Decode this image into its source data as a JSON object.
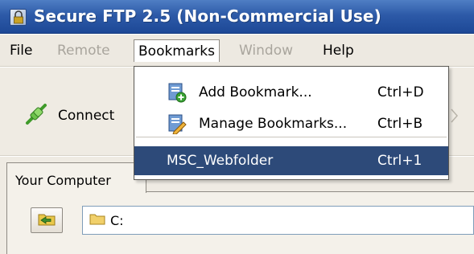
{
  "window": {
    "title": "Secure FTP 2.5 (Non-Commercial Use)"
  },
  "menubar": {
    "items": [
      {
        "label": "File",
        "enabled": true
      },
      {
        "label": "Remote",
        "enabled": false
      },
      {
        "label": "Bookmarks",
        "enabled": true,
        "open": true
      },
      {
        "label": "Window",
        "enabled": false
      },
      {
        "label": "Help",
        "enabled": true
      }
    ]
  },
  "bookmarks_menu": {
    "items": [
      {
        "label": "Add Bookmark...",
        "shortcut": "Ctrl+D",
        "icon": "add-bookmark-icon"
      },
      {
        "label": "Manage Bookmarks...",
        "shortcut": "Ctrl+B",
        "icon": "manage-bookmarks-icon"
      },
      {
        "label": "MSC_Webfolder",
        "shortcut": "Ctrl+1",
        "selected": true
      }
    ]
  },
  "toolbar": {
    "connect_label": "Connect",
    "connect_icon": "plug-icon"
  },
  "local_panel": {
    "tab_label": "Your Computer",
    "path_value": "C:",
    "back_icon": "folder-back-icon"
  },
  "colors": {
    "titlebar": "#2d5aa8",
    "menu_highlight": "#2d4a79",
    "menubar": "#ede9e1"
  }
}
